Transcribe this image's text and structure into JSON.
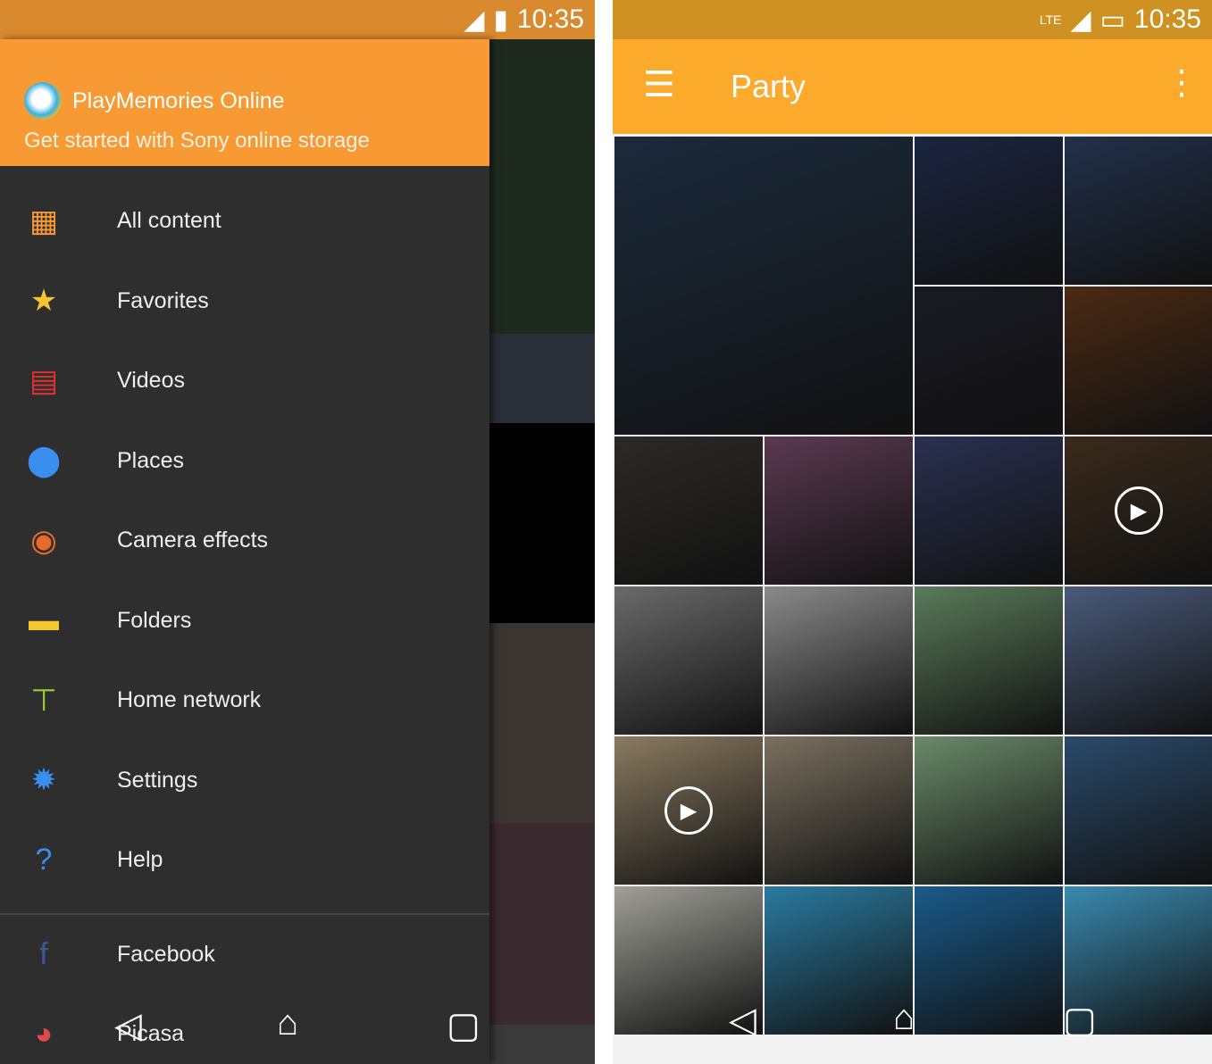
{
  "left": {
    "status": {
      "time": "10:35"
    },
    "header": {
      "title": "PlayMemories Online",
      "subtitle": "Get started with Sony online storage"
    },
    "menu": [
      {
        "label": "All content",
        "icon": "all-content-icon",
        "glyph": "▦",
        "color": "#f89a34"
      },
      {
        "label": "Favorites",
        "icon": "star-icon",
        "glyph": "★",
        "color": "#f4c430"
      },
      {
        "label": "Videos",
        "icon": "film-icon",
        "glyph": "▤",
        "color": "#e03030"
      },
      {
        "label": "Places",
        "icon": "location-pin-icon",
        "glyph": "⬤",
        "color": "#3a8ef0"
      },
      {
        "label": "Camera effects",
        "icon": "camera-effects-icon",
        "glyph": "◉",
        "color": "#e86a2a"
      },
      {
        "label": "Folders",
        "icon": "folder-icon",
        "glyph": "▬",
        "color": "#f2c82e"
      },
      {
        "label": "Home network",
        "icon": "home-network-icon",
        "glyph": "⊤",
        "color": "#9acd32"
      },
      {
        "label": "Settings",
        "icon": "gear-icon",
        "glyph": "✹",
        "color": "#3a8ef0"
      },
      {
        "label": "Help",
        "icon": "help-icon",
        "glyph": "?",
        "color": "#3a8ef0"
      }
    ],
    "services": [
      {
        "label": "Facebook",
        "icon": "facebook-icon",
        "glyph": "f",
        "color": "#3b5998"
      },
      {
        "label": "Picasa",
        "icon": "picasa-icon",
        "glyph": "◕",
        "color": "#e04a4a"
      }
    ],
    "background_colors": [
      "#1f2a1f",
      "#2a2f38",
      "#000000",
      "#3a3530",
      "#3b2a30",
      "#3a3a3a"
    ]
  },
  "right": {
    "status": {
      "network": "LTE",
      "time": "10:35"
    },
    "appbar": {
      "title": "Party"
    },
    "tiles": [
      {
        "big": true,
        "color": "#1c2a3c"
      },
      {
        "color": "#1b2540"
      },
      {
        "color": "#22304a"
      },
      {
        "color": "#1a1a24"
      },
      {
        "color": "#4a2a14"
      },
      {
        "color": "#2c2a28"
      },
      {
        "color": "#5a3a50"
      },
      {
        "color": "#2a3050"
      },
      {
        "color": "#3a2a1c",
        "video": true
      },
      {
        "color": "#6a6a6a"
      },
      {
        "color": "#8a8a8a"
      },
      {
        "color": "#5a7a5a"
      },
      {
        "color": "#4a5a7a"
      },
      {
        "color": "#8a7a60",
        "video": true
      },
      {
        "color": "#7a7060"
      },
      {
        "color": "#6a8a6a"
      },
      {
        "color": "#2a4a6a"
      },
      {
        "color": "#a0a098"
      },
      {
        "color": "#2a7aa0"
      },
      {
        "color": "#1a5a8a"
      },
      {
        "color": "#3a8ab0"
      }
    ]
  }
}
